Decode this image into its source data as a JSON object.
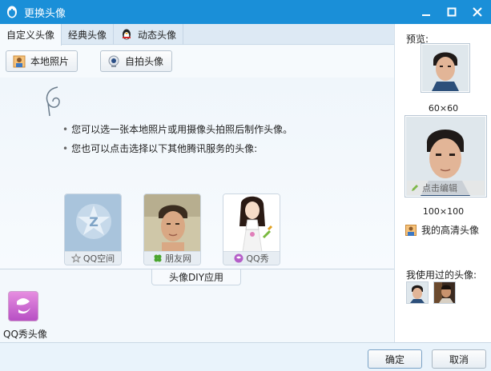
{
  "window": {
    "title": "更换头像",
    "minimize": "▬",
    "maximize": "▢",
    "close": "✕"
  },
  "tabs": [
    {
      "label": "自定义头像",
      "active": true
    },
    {
      "label": "经典头像",
      "active": false
    },
    {
      "label": "动态头像",
      "active": false,
      "icon": "penguin-icon"
    }
  ],
  "toolbar": {
    "local_photo": "本地照片",
    "selfie": "自拍头像"
  },
  "hints": [
    "您可以选一张本地照片或用摄像头拍照后制作头像。",
    "您也可以点击选择以下其他腾讯服务的头像:"
  ],
  "services": [
    {
      "label": "QQ空间",
      "icon": "qzone-star-icon"
    },
    {
      "label": "朋友网",
      "icon": "clover-icon"
    },
    {
      "label": "QQ秀",
      "icon": "qqshow-icon"
    }
  ],
  "diy": {
    "tab_label": "头像DIY应用",
    "app_label": "QQ秀头像"
  },
  "preview": {
    "label": "预览:",
    "small_size": "60×60",
    "large_size": "100×100",
    "edit_label": "点击编辑",
    "hd_link": "我的高清头像"
  },
  "used": {
    "label": "我使用过的头像:"
  },
  "buttons": {
    "ok": "确定",
    "cancel": "取消"
  },
  "colors": {
    "titlebar": "#1a8fd8",
    "panel": "#f3f8fc",
    "accent": "#7aa2c6"
  }
}
